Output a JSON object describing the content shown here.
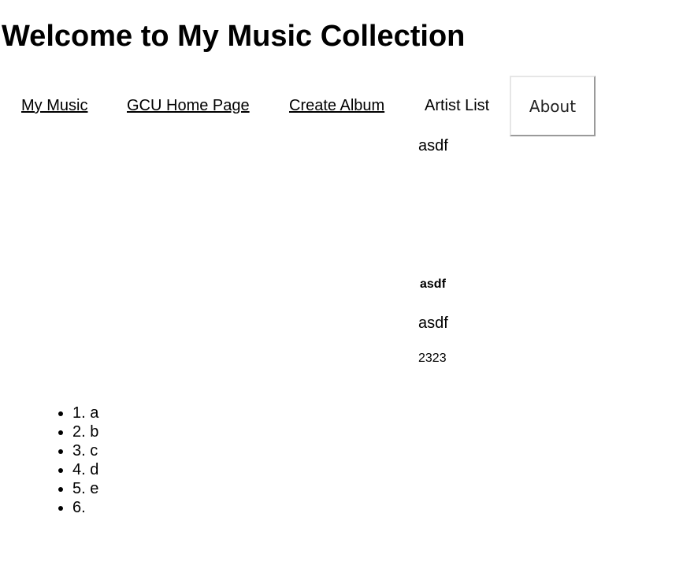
{
  "header": {
    "title": "Welcome to My Music Collection"
  },
  "nav": {
    "my_music": "My Music",
    "gcu_home": "GCU Home Page",
    "create_album": "Create Album",
    "artist_list": "Artist List",
    "about": "About"
  },
  "album": {
    "title": "asdf",
    "subtitle": "asdf",
    "artist": "asdf",
    "year": "2323"
  },
  "tracks": [
    "1. a",
    "2. b",
    "3. c",
    "4. d",
    "5. e",
    "6."
  ]
}
